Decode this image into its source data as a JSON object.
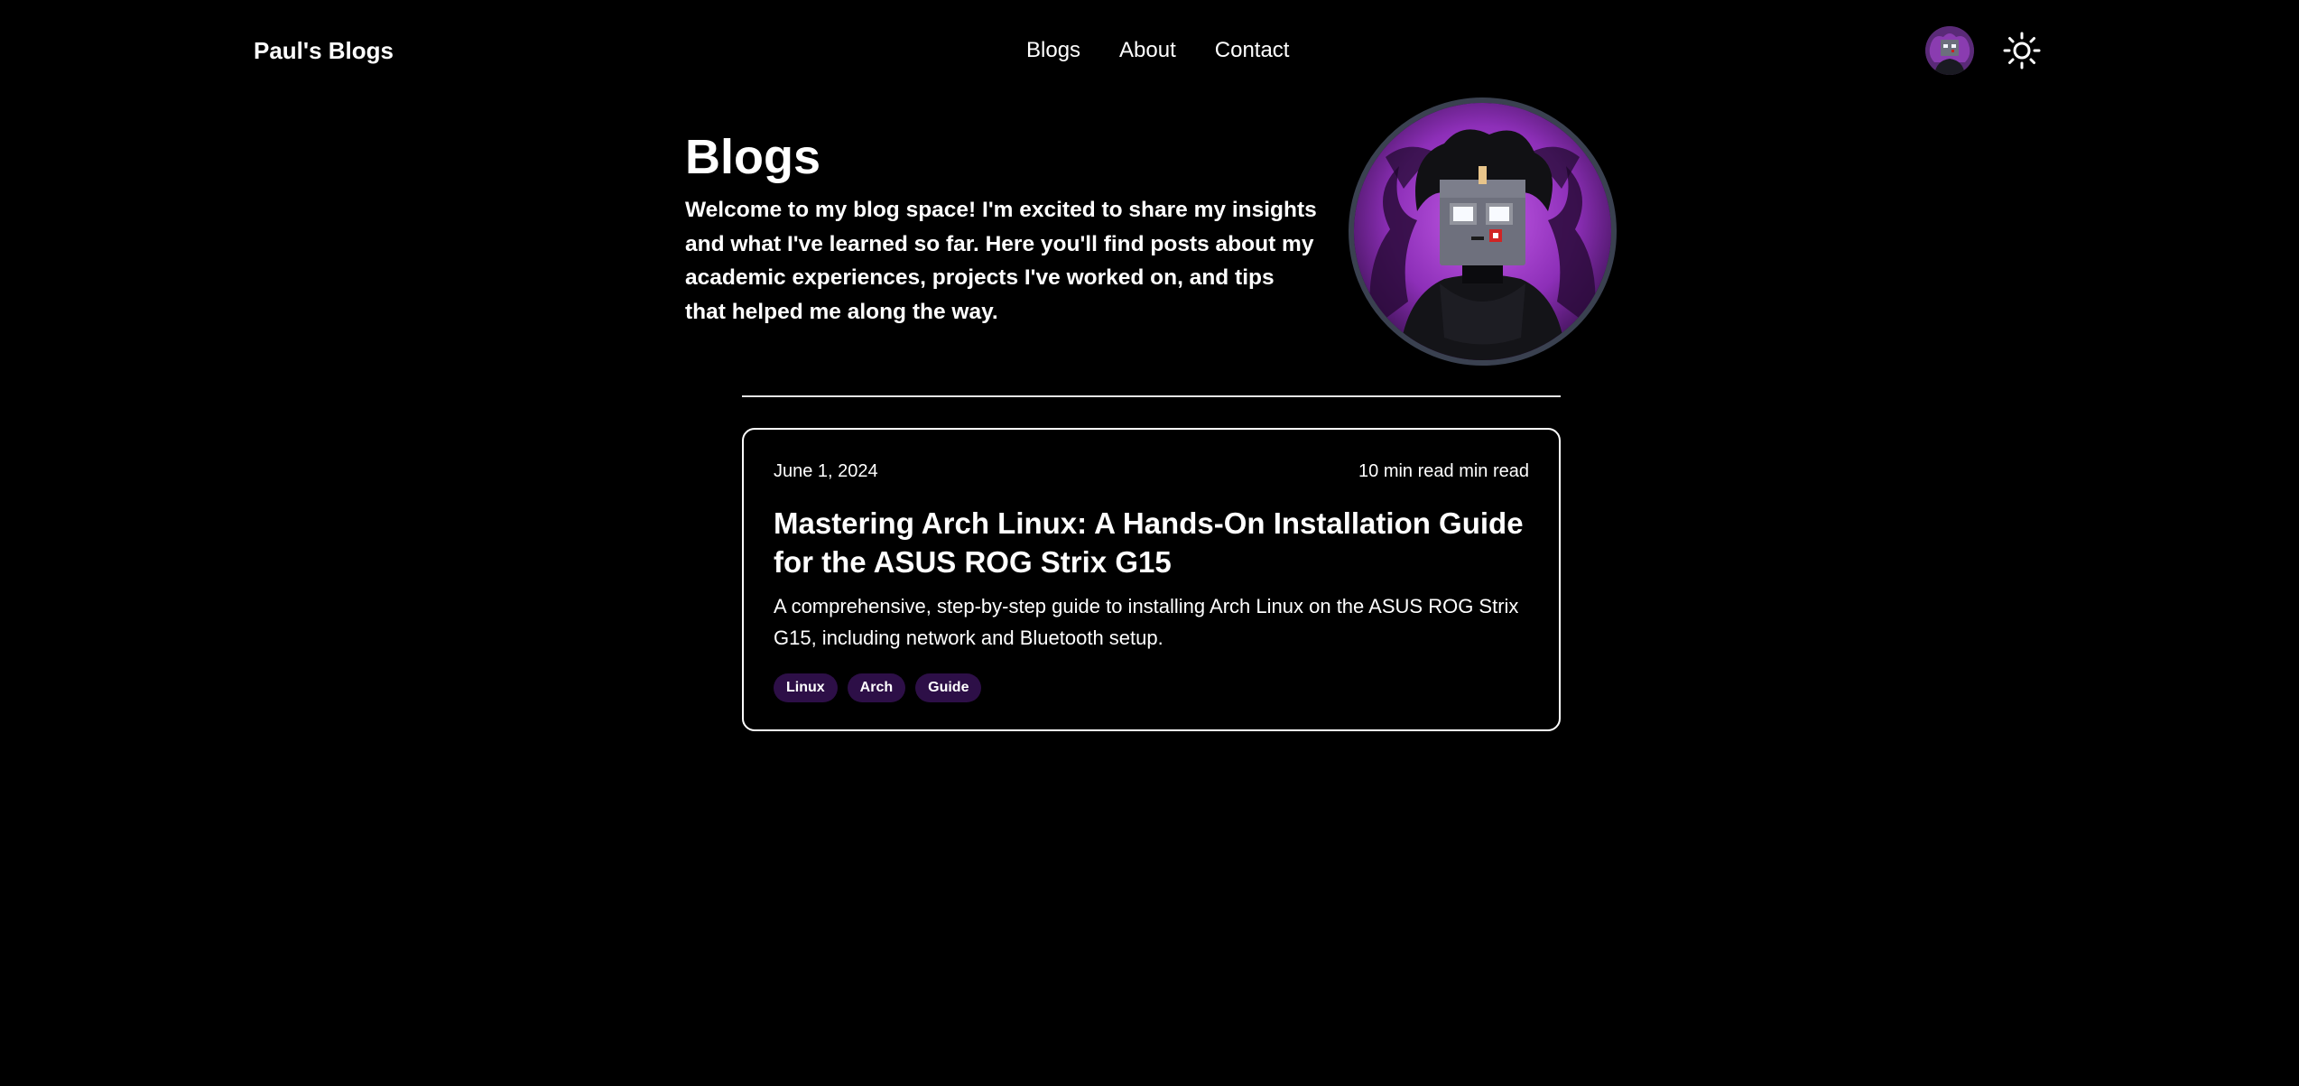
{
  "header": {
    "brand": "Paul's Blogs",
    "nav": [
      {
        "label": "Blogs"
      },
      {
        "label": "About"
      },
      {
        "label": "Contact"
      }
    ],
    "theme_icon": "sun-icon"
  },
  "hero": {
    "title": "Blogs",
    "intro": "Welcome to my blog space! I'm excited to share my insights and what I've learned so far. Here you'll find posts about my academic experiences, projects I've worked on, and tips that helped me along the way."
  },
  "posts": [
    {
      "date": "June 1, 2024",
      "read_time": "10 min read min read",
      "title": "Mastering Arch Linux: A Hands-On Installation Guide for the ASUS ROG Strix G15",
      "description": "A comprehensive, step-by-step guide to installing Arch Linux on the ASUS ROG Strix G15, including network and Bluetooth setup.",
      "tags": [
        "Linux",
        "Arch",
        "Guide"
      ]
    }
  ],
  "colors": {
    "background": "#000000",
    "text": "#ffffff",
    "tag_bg": "#2d0f47",
    "avatar_ring": "#3a4150",
    "avatar_purple": "#a43ad1"
  }
}
